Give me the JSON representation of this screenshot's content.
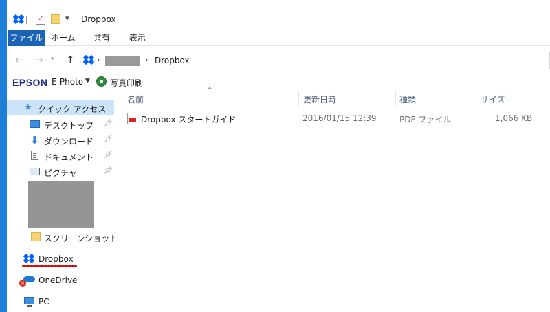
{
  "window": {
    "title": "Dropbox"
  },
  "ribbon": {
    "tabs": [
      "ファイル",
      "ホーム",
      "共有",
      "表示"
    ]
  },
  "address": {
    "current": "Dropbox"
  },
  "epson": {
    "logo": "EPSON",
    "ephoto": "E-Photo",
    "print_label": "写真印刷"
  },
  "nav_pane": {
    "quick_access": "クイック アクセス",
    "desktop": "デスクトップ",
    "downloads": "ダウンロード",
    "documents": "ドキュメント",
    "pictures": "ピクチャ",
    "screenshots": "スクリーンショット",
    "dropbox": "Dropbox",
    "onedrive": "OneDrive",
    "pc": "PC"
  },
  "columns": {
    "name": "名前",
    "date": "更新日時",
    "type": "種類",
    "size": "サイズ"
  },
  "files": [
    {
      "name": "Dropbox スタートガイド",
      "date": "2016/01/15 12:39",
      "type": "PDF ファイル",
      "size": "1,066 KB"
    }
  ],
  "colors": {
    "accent": "#1a63b5",
    "selection": "#cce4f7",
    "dropbox_blue": "#0061fe",
    "desktop_edge": "#1d7fd8"
  }
}
